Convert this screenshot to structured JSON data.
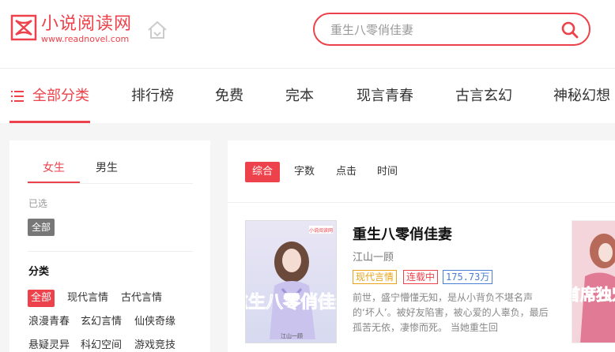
{
  "logo": {
    "name": "小说阅读网",
    "url": "www.readnovel.com",
    "brand_color": "#ed424b"
  },
  "search": {
    "placeholder": "重生八零俏佳妻"
  },
  "nav": {
    "items": [
      "全部分类",
      "排行榜",
      "免费",
      "完本",
      "现言青春",
      "古言玄幻",
      "神秘幻想"
    ]
  },
  "sidebar": {
    "tabs": [
      "女生",
      "男生"
    ],
    "selected_label": "已选",
    "selected_chip": "全部",
    "category_title": "分类",
    "categories": [
      "全部",
      "现代言情",
      "古代言情",
      "浪漫青春",
      "玄幻言情",
      "仙侠奇缘",
      "悬疑灵异",
      "科幻空间",
      "游戏竞技"
    ]
  },
  "main": {
    "sorts": [
      "综合",
      "字数",
      "点击",
      "时间"
    ],
    "book": {
      "title": "重生八零俏佳妻",
      "author": "江山一顾",
      "tags": [
        "现代言情",
        "连载中",
        "175.73万"
      ],
      "description": "前世，盛宁懵懂无知，是从小背负不堪名声的‘坏人’。被好友陷害，被心爱的人辜负，最后孤苦无依，凄惨而死。 当她重生回",
      "cover_title": "重生八零俏佳妻",
      "cover_author": "江山一顾",
      "cover_badge": "小说阅读网"
    },
    "book2": {
      "cover_title": "首席独宠"
    }
  }
}
